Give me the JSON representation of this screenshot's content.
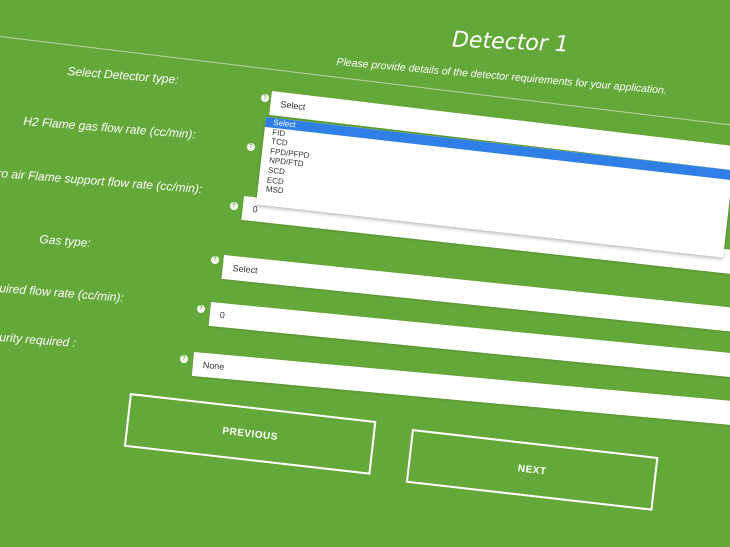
{
  "header": {
    "title": "Detector 1",
    "subtitle": "Please provide details of the detector requirements for your application."
  },
  "form": {
    "labels": {
      "detector_type": "Select Detector type:",
      "h2_flow": "H2 Flame gas flow rate (cc/min):",
      "air_flow": "ro air Flame support flow rate (cc/min):",
      "gas_type": "Gas type:",
      "required_flow": "uired flow rate (cc/min):",
      "purity": "urity required :"
    },
    "detector_type_value": "Select",
    "detector_options": [
      "Select",
      "FID",
      "TCD",
      "FPD/PFPD",
      "NPD/FTD",
      "SCD",
      "ECD",
      "MSD"
    ],
    "detector_selected_index": 0,
    "air_flow_value": "0",
    "gas_type_value": "Select",
    "required_flow_value": "0",
    "purity_value": "None",
    "help_glyph": "?"
  },
  "buttons": {
    "previous": "PREVIOUS",
    "next": "NEXT"
  },
  "colors": {
    "background": "#65a83a",
    "highlight": "#2f7fe6"
  }
}
